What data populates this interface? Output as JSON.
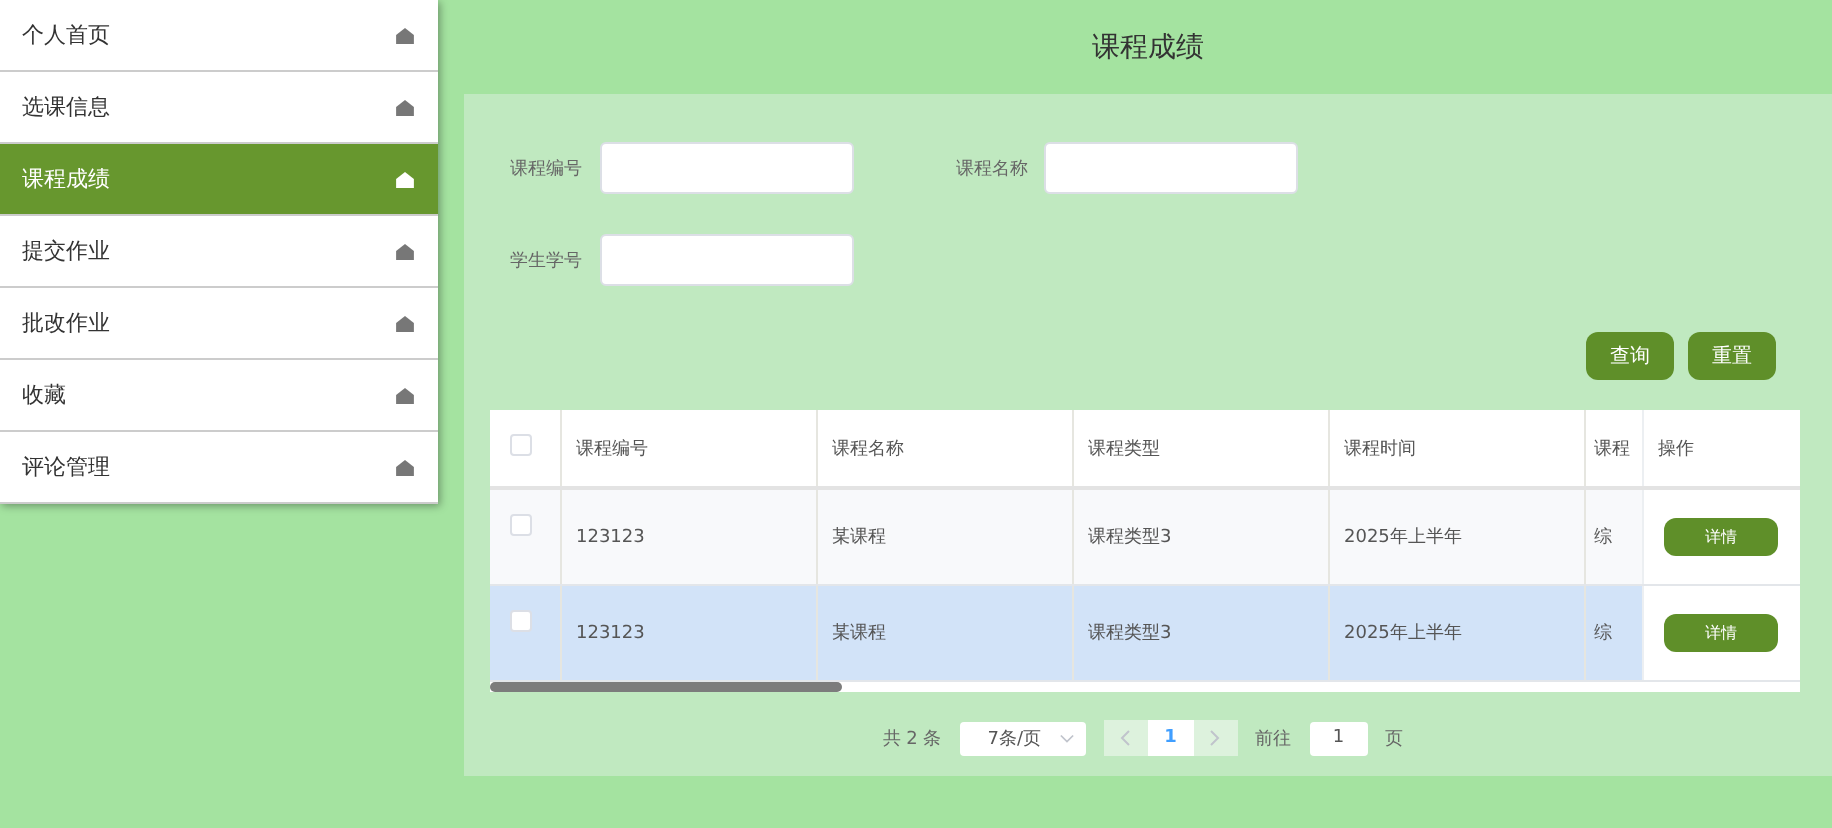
{
  "sidebar": {
    "items": [
      {
        "label": "个人首页",
        "selected": false
      },
      {
        "label": "选课信息",
        "selected": false
      },
      {
        "label": "课程成绩",
        "selected": true
      },
      {
        "label": "提交作业",
        "selected": false
      },
      {
        "label": "批改作业",
        "selected": false
      },
      {
        "label": "收藏",
        "selected": false
      },
      {
        "label": "评论管理",
        "selected": false
      }
    ]
  },
  "page_title": "课程成绩",
  "filters": [
    {
      "label": "课程编号"
    },
    {
      "label": "课程名称"
    },
    {
      "label": "学生学号"
    }
  ],
  "buttons": [
    {
      "label": "查询"
    },
    {
      "label": "重置"
    }
  ],
  "table": {
    "select_all_checked": false,
    "columns": [
      "课程编号",
      "课程名称",
      "课程类型",
      "课程时间",
      "课程"
    ],
    "action_column": "操作",
    "rows": [
      {
        "checked": false,
        "hovered": false,
        "cells": [
          "123123",
          "某课程",
          "课程类型3",
          "2025年上半年",
          "综"
        ],
        "action": "详情"
      },
      {
        "checked": false,
        "hovered": true,
        "cells": [
          "123123",
          "某课程",
          "课程类型3",
          "2025年上半年",
          "综"
        ],
        "action": "详情"
      }
    ]
  },
  "pagination": {
    "total": "共 2 条",
    "page_size": "7条/页",
    "pages": [
      {
        "label": "1",
        "selected": true
      }
    ],
    "goto_label": "前往",
    "goto_value": "1",
    "goto_suffix": "页"
  }
}
